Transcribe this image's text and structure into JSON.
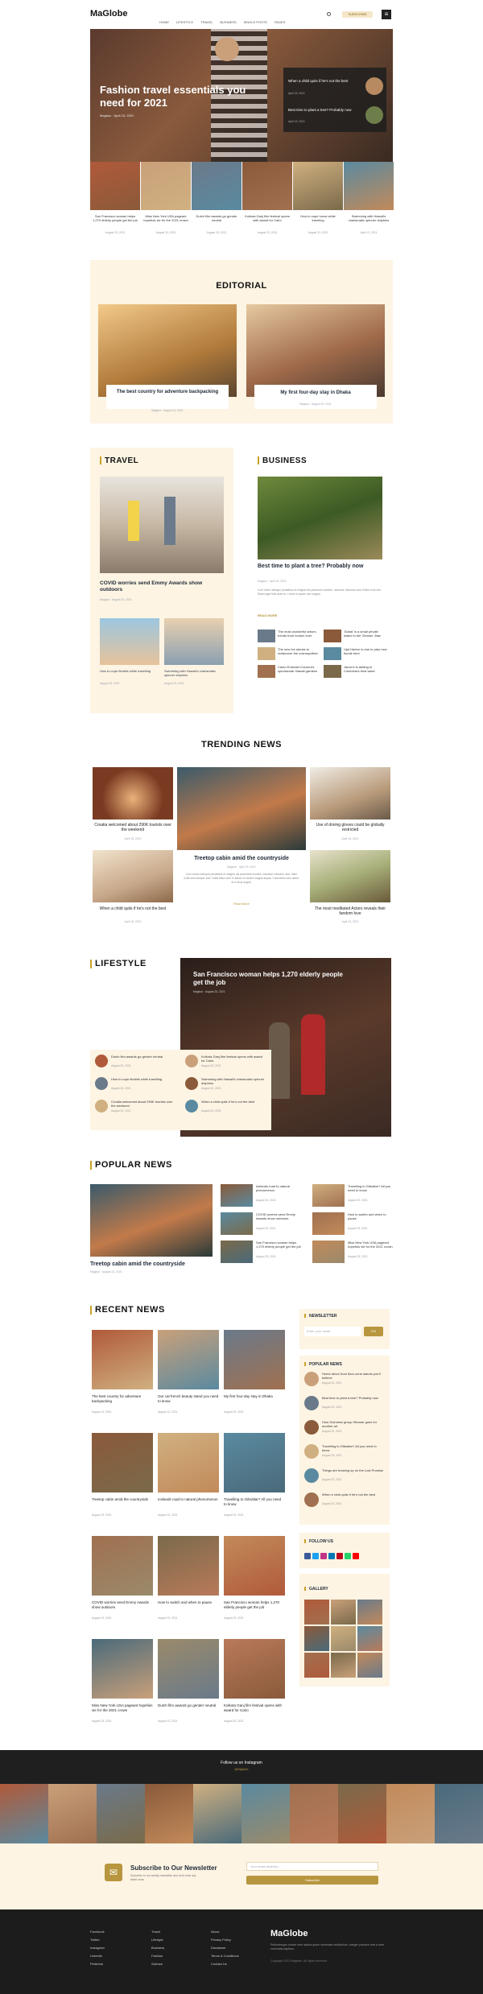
{
  "brand": {
    "logo": "MaGlobe",
    "accent": "#c9a227"
  },
  "nav": {
    "items": [
      "HOME",
      "LIFESTYLE",
      "TRAVEL",
      "BUSINESS",
      "SINGLE POSTS",
      "PAGES"
    ],
    "subscribe": "SUBSCRIBE"
  },
  "hero": {
    "title": "Fashion travel essentials you need for 2021",
    "meta": "Magbox · April 15, 2021",
    "side": [
      {
        "title": "When a child quits if he's not the best",
        "date": "April 15, 2021"
      },
      {
        "title": "Best time to plant a tree? Probably now",
        "date": "April 15, 2021"
      }
    ]
  },
  "strip": [
    {
      "t": "San Francisco woman helps 1,270 elderly people get the job",
      "d": "August 23, 2021"
    },
    {
      "t": "Miss New York USA pageant hopefuls vie for the 2021 crown",
      "d": "August 23, 2021"
    },
    {
      "t": "Dutch film awards go gender neutral",
      "d": "August 23, 2021"
    },
    {
      "t": "Kolkota Ganj film festival opens with award for Cairo",
      "d": "August 23, 2021"
    },
    {
      "t": "How to cope horse while traveling",
      "d": "August 23, 2021"
    },
    {
      "t": "Swimming with Hawaii's charismatic spinner dolphins",
      "d": "April 12, 2021"
    }
  ],
  "editorial": {
    "title": "EDITORIAL",
    "cards": [
      {
        "t": "The best country for adventure backpacking",
        "m": "Magbox · August 12, 2021"
      },
      {
        "t": "My first four-day stay in Dhaka",
        "m": "Magbox · August 15, 2021"
      }
    ]
  },
  "travel": {
    "title": "TRAVEL",
    "main": {
      "t": "COVID worries send Emmy Awards show outdoors",
      "m": "Magbox · August 23, 2021"
    },
    "small": [
      {
        "t": "How to cope flexible while travelling",
        "m": "August 23, 2021"
      },
      {
        "t": "Swimming with Hawaii's charismatic spinner dolphins",
        "m": "August 23, 2021"
      }
    ]
  },
  "business": {
    "title": "BUSINESS",
    "main": {
      "t": "Best time to plant a tree? Probably now",
      "m": "Magbox · April 15, 2021",
      "ex": "Cum socis natoque penatibus et magnis dis parturient montes, nascetur ridiculus mus. Etiam eros nisl. Etiam eget felis ante ex. Lorem et quam nec magna.",
      "more": "READ MORE"
    },
    "list": [
      {
        "t": "The most wonderful arbors trends from london ever"
      },
      {
        "t": "'Dubai' is a small private island in the Cleaner Jhaz"
      },
      {
        "t": "The new fox stories to rediscover the cosmopolitan"
      },
      {
        "t": "Ujal Harbor is due to plan new floods here"
      },
      {
        "t": "Canto Emerald Coconut's spectacular Hawaii gardens"
      },
      {
        "t": "Jacob's Is adding to Colombia's best wave"
      }
    ]
  },
  "trending": {
    "title": "TRENDING NEWS",
    "cards": [
      {
        "t": "Croatia welcomed about 290K tourists over the weekend",
        "d": "April 15, 2021"
      },
      {
        "t": "Use of driving gloves could be globally restricted",
        "d": "April 15, 2021"
      },
      {
        "t": "When a child quits if he's not the best",
        "d": "April 15, 2021"
      },
      {
        "t": "The most meditated Actors reveals their fandom love",
        "d": "April 15, 2021"
      }
    ],
    "center": {
      "t": "Treetop cabin amid the countryside",
      "m": "Magbox · April 15, 2021",
      "ex": "Cum sociis natoque penatibus et magnis dis parturient montes, nascetur ridiculus mus. Nam nulla sem semper sed. Nulla tellus sem in labore et dolore magna aliqua. Cras tellus odio ullam, et a risus augue.",
      "more": "Read More"
    }
  },
  "lifestyle": {
    "title": "LIFESTYLE",
    "hero": {
      "t": "San Francisco woman helps 1,270 elderly people get the job",
      "m": "Magbox · August 23, 2021"
    },
    "items": [
      {
        "t": "Dutch film awards go gender neutral",
        "d": "August 23, 2021"
      },
      {
        "t": "Kolkota Ganj film festival opens with award for Cairo",
        "d": "August 23, 2021"
      },
      {
        "t": "How to cope flexible while travelling",
        "d": "August 23, 2021"
      },
      {
        "t": "Swimming with Hawaii's charismatic spinner dolphins",
        "d": "August 23, 2021"
      },
      {
        "t": "Croatia welcomed about 290K tourists over the weekend",
        "d": "August 23, 2021"
      },
      {
        "t": "When a child quits if he's not the best",
        "d": "August 23, 2021"
      }
    ]
  },
  "popular": {
    "title": "POPULAR NEWS",
    "main": {
      "t": "Treetop cabin amid the countryside",
      "m": "Magbox · August 23, 2021"
    },
    "items": [
      {
        "t": "Icelands road to natural phenomenon",
        "d": "August 23, 2021"
      },
      {
        "t": "Travelling to Gibraltar? All you need to know",
        "d": "August 23, 2021"
      },
      {
        "t": "COVID worries send Emmy Awards show outdoors",
        "d": "August 23, 2021"
      },
      {
        "t": "How to switch and when to pause",
        "d": "August 23, 2021"
      },
      {
        "t": "San Francisco woman helps 1,270 elderly people get the job",
        "d": "August 23, 2021"
      },
      {
        "t": "Miss New York USA pageant hopefuls vie for the 2021 crown",
        "d": "August 23, 2021"
      }
    ]
  },
  "recent": {
    "title": "RECENT NEWS",
    "cards": [
      {
        "t": "The best country for adventure backpacking",
        "d": "August 12, 2021"
      },
      {
        "t": "Our cat french beauty stand you need to know",
        "d": "August 12, 2021"
      },
      {
        "t": "My first four-day stay in Dhaka",
        "d": "August 15, 2021"
      },
      {
        "t": "Treetop cabin amid the countryside",
        "d": "August 23, 2021"
      },
      {
        "t": "Icelands road to natural phenomenon",
        "d": "August 23, 2021"
      },
      {
        "t": "Travelling to Gibraltar? All you need to know",
        "d": "August 23, 2021"
      },
      {
        "t": "COVID worries send Emmy Awards show outdoors",
        "d": "August 23, 2021"
      },
      {
        "t": "How to switch and when to pause",
        "d": "August 23, 2021"
      },
      {
        "t": "San Francisco woman helps 1,270 elderly people get the job",
        "d": "August 23, 2021"
      },
      {
        "t": "Miss New York USA pageant hopefuls vie for the 2021 crown",
        "d": "August 23, 2021"
      },
      {
        "t": "Dutch film awards go gender neutral",
        "d": "August 23, 2021"
      },
      {
        "t": "Kolkota Ganj film festival opens with award for Cairo",
        "d": "August 23, 2021"
      }
    ]
  },
  "sidebar": {
    "newsletter": {
      "title": "NEWSLETTER",
      "placeholder": "Enter your email",
      "btn": "GO"
    },
    "popular_title": "POPULAR NEWS",
    "popular": [
      {
        "t": "Home decor from floor-zone stands you'll believe",
        "d": "August 23, 2021"
      },
      {
        "t": "Best time to plant a tree? Probably now",
        "d": "August 23, 2021"
      },
      {
        "t": "How Guinness group Hibanar goes for another art",
        "d": "August 23, 2021"
      },
      {
        "t": "Travelling to Gibraltar? All you need to know",
        "d": "August 23, 2021"
      },
      {
        "t": "Things are brewing up on the Lost Promise",
        "d": "August 23, 2021"
      },
      {
        "t": "When a child quits if he's not the best",
        "d": "August 23, 2021"
      }
    ],
    "follow_title": "FOLLOW US",
    "gallery_title": "GALLERY"
  },
  "instagram": {
    "title": "Follow us on Instagram",
    "handle": "@Mglobe"
  },
  "subscribe": {
    "title": "Subscribe to Our Newsletter",
    "desc": "Subscribe to our weekly newsletter and don't miss any latest news",
    "placeholder": "Your email address...",
    "btn": "Subscribe"
  },
  "footer": {
    "col1": [
      "Facebook",
      "Twitter",
      "Instagram",
      "LinkedIn",
      "Pinterest"
    ],
    "col2": [
      "Travel",
      "Lifestyle",
      "Business",
      "Fashion",
      "Science"
    ],
    "col3": [
      "About",
      "Privacy Policy",
      "Disclaimer",
      "Terms & Conditions",
      "Contact Us"
    ],
    "logo": "MaGlobe",
    "desc": "Pellentesque ornare sem lacinia quam venenatis vestibulum. Integer posuere erat a ante venenatis dapibus.",
    "copy": "Copyright 2021 Maglobe. All rights reserved."
  }
}
